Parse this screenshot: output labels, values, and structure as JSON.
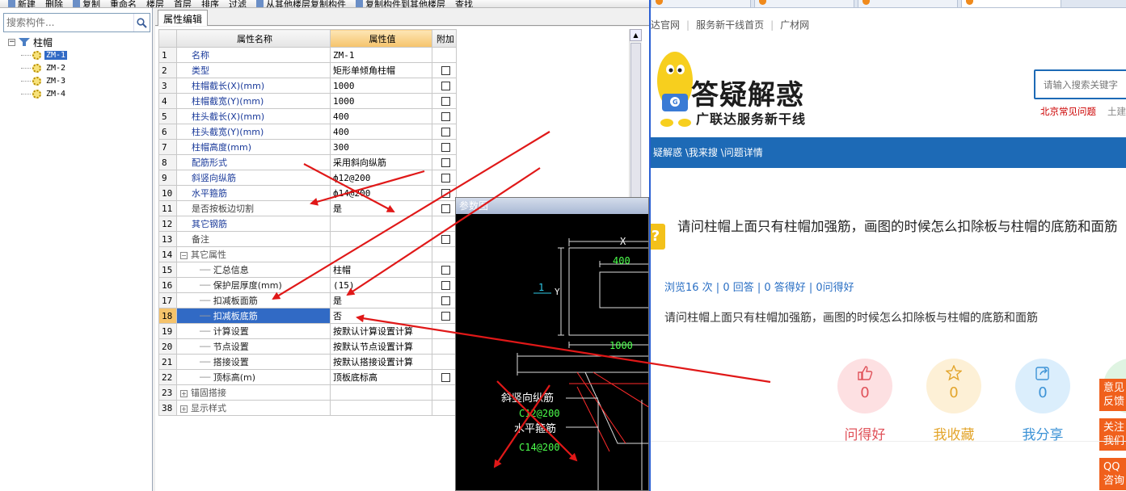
{
  "toolbar": {
    "items": [
      "新建",
      "删除",
      "复制",
      "重命名",
      "楼层",
      "首层",
      "排序",
      "过滤",
      "从其他楼层复制构件",
      "复制构件到其他楼层",
      "查找"
    ]
  },
  "left_panel": {
    "search_placeholder": "搜索构件...",
    "tree_root": "柱帽",
    "tree_items": [
      "ZM-1",
      "ZM-2",
      "ZM-3",
      "ZM-4"
    ],
    "selected_item": "ZM-1"
  },
  "editor": {
    "tab_label": "属性编辑",
    "headers": {
      "name": "属性名称",
      "value": "属性值",
      "extra": "附加"
    },
    "rows": [
      {
        "num": "1",
        "name": "名称",
        "value": "ZM-1",
        "checkbox": false,
        "style": "blue"
      },
      {
        "num": "2",
        "name": "类型",
        "value": "矩形单倾角柱帽",
        "checkbox": true,
        "style": "blue"
      },
      {
        "num": "3",
        "name": "柱帽截长(X)(mm)",
        "value": "1000",
        "checkbox": true,
        "style": "blue"
      },
      {
        "num": "4",
        "name": "柱帽截宽(Y)(mm)",
        "value": "1000",
        "checkbox": true,
        "style": "blue"
      },
      {
        "num": "5",
        "name": "柱头截长(X)(mm)",
        "value": "400",
        "checkbox": true,
        "style": "blue"
      },
      {
        "num": "6",
        "name": "柱头截宽(Y)(mm)",
        "value": "400",
        "checkbox": true,
        "style": "blue"
      },
      {
        "num": "7",
        "name": "柱帽高度(mm)",
        "value": "300",
        "checkbox": true,
        "style": "blue"
      },
      {
        "num": "8",
        "name": "配筋形式",
        "value": "采用斜向纵筋",
        "checkbox": true,
        "style": "blue"
      },
      {
        "num": "9",
        "name": "斜竖向纵筋",
        "value": "ф12@200",
        "checkbox": true,
        "style": "blue"
      },
      {
        "num": "10",
        "name": "水平箍筋",
        "value": "ф14@200",
        "checkbox": true,
        "style": "blue"
      },
      {
        "num": "11",
        "name": "是否按板边切割",
        "value": "是",
        "checkbox": true,
        "style": "grey"
      },
      {
        "num": "12",
        "name": "其它钢筋",
        "value": "",
        "checkbox": false,
        "style": "blue"
      },
      {
        "num": "13",
        "name": "备注",
        "value": "",
        "checkbox": true,
        "style": "grey"
      },
      {
        "num": "14",
        "name": "其它属性",
        "value": "",
        "checkbox": false,
        "style": "group",
        "expander": "−"
      },
      {
        "num": "15",
        "name": "汇总信息",
        "value": "柱帽",
        "checkbox": true,
        "style": "sub"
      },
      {
        "num": "16",
        "name": "保护层厚度(mm)",
        "value": "(15)",
        "checkbox": true,
        "style": "sub"
      },
      {
        "num": "17",
        "name": "扣减板面筋",
        "value": "是",
        "checkbox": true,
        "style": "sub"
      },
      {
        "num": "18",
        "name": "扣减板底筋",
        "value": "否",
        "checkbox": true,
        "style": "sub",
        "selected": true
      },
      {
        "num": "19",
        "name": "计算设置",
        "value": "按默认计算设置计算",
        "checkbox": false,
        "style": "sub"
      },
      {
        "num": "20",
        "name": "节点设置",
        "value": "按默认节点设置计算",
        "checkbox": false,
        "style": "sub"
      },
      {
        "num": "21",
        "name": "搭接设置",
        "value": "按默认搭接设置计算",
        "checkbox": false,
        "style": "sub"
      },
      {
        "num": "22",
        "name": "顶标高(m)",
        "value": "顶板底标高",
        "checkbox": true,
        "style": "sub"
      },
      {
        "num": "23",
        "name": "锚固搭接",
        "value": "",
        "checkbox": false,
        "style": "group",
        "expander": "+"
      },
      {
        "num": "38",
        "name": "显示样式",
        "value": "",
        "checkbox": false,
        "style": "group",
        "expander": "+"
      }
    ]
  },
  "ref_dialog": {
    "title": "参数图",
    "labels": {
      "x": "X",
      "y": "Y",
      "one": "1",
      "w400": "400",
      "w1000": "1000",
      "rebar1": "斜竖向纵筋",
      "rebar1_spec": "C12@200",
      "rebar2": "水平箍筋",
      "rebar2_spec": "C14@200"
    }
  },
  "browser": {
    "nav_links": [
      "达官网",
      "服务新干线首页",
      "广材网"
    ],
    "logo_title": "答疑解惑",
    "logo_subtitle": "广联达服务新干线",
    "search_placeholder": "请输入搜索关键字",
    "hot_links": [
      "北京常见问题",
      "土建"
    ],
    "breadcrumb": "疑解惑 \\我来搜 \\问题详情",
    "question_title": "请问柱帽上面只有柱帽加强筋，画图的时候怎么扣除板与柱帽的底筋和面筋",
    "stats": "浏览16 次 | 0 回答 | 0 答得好 | 0问得好",
    "question_body": "请问柱帽上面只有柱帽加强筋，画图的时候怎么扣除板与柱帽的底筋和面筋",
    "actions": [
      {
        "label": "问得好",
        "count": "0",
        "color": "#e0525a",
        "bg": "#fde0e2",
        "icon": "thumb-up-icon"
      },
      {
        "label": "我收藏",
        "count": "0",
        "color": "#e3a52c",
        "bg": "#fdf0d6",
        "icon": "star-icon"
      },
      {
        "label": "我分享",
        "count": "0",
        "color": "#3d93d6",
        "bg": "#dbeefc",
        "icon": "share-icon"
      }
    ],
    "side_buttons": [
      "意见反馈",
      "关注我们",
      "QQ咨询"
    ]
  },
  "colors": {
    "accent_blue": "#1d6ab6",
    "annotation_red": "#e01818",
    "selection": "#316ac5"
  }
}
